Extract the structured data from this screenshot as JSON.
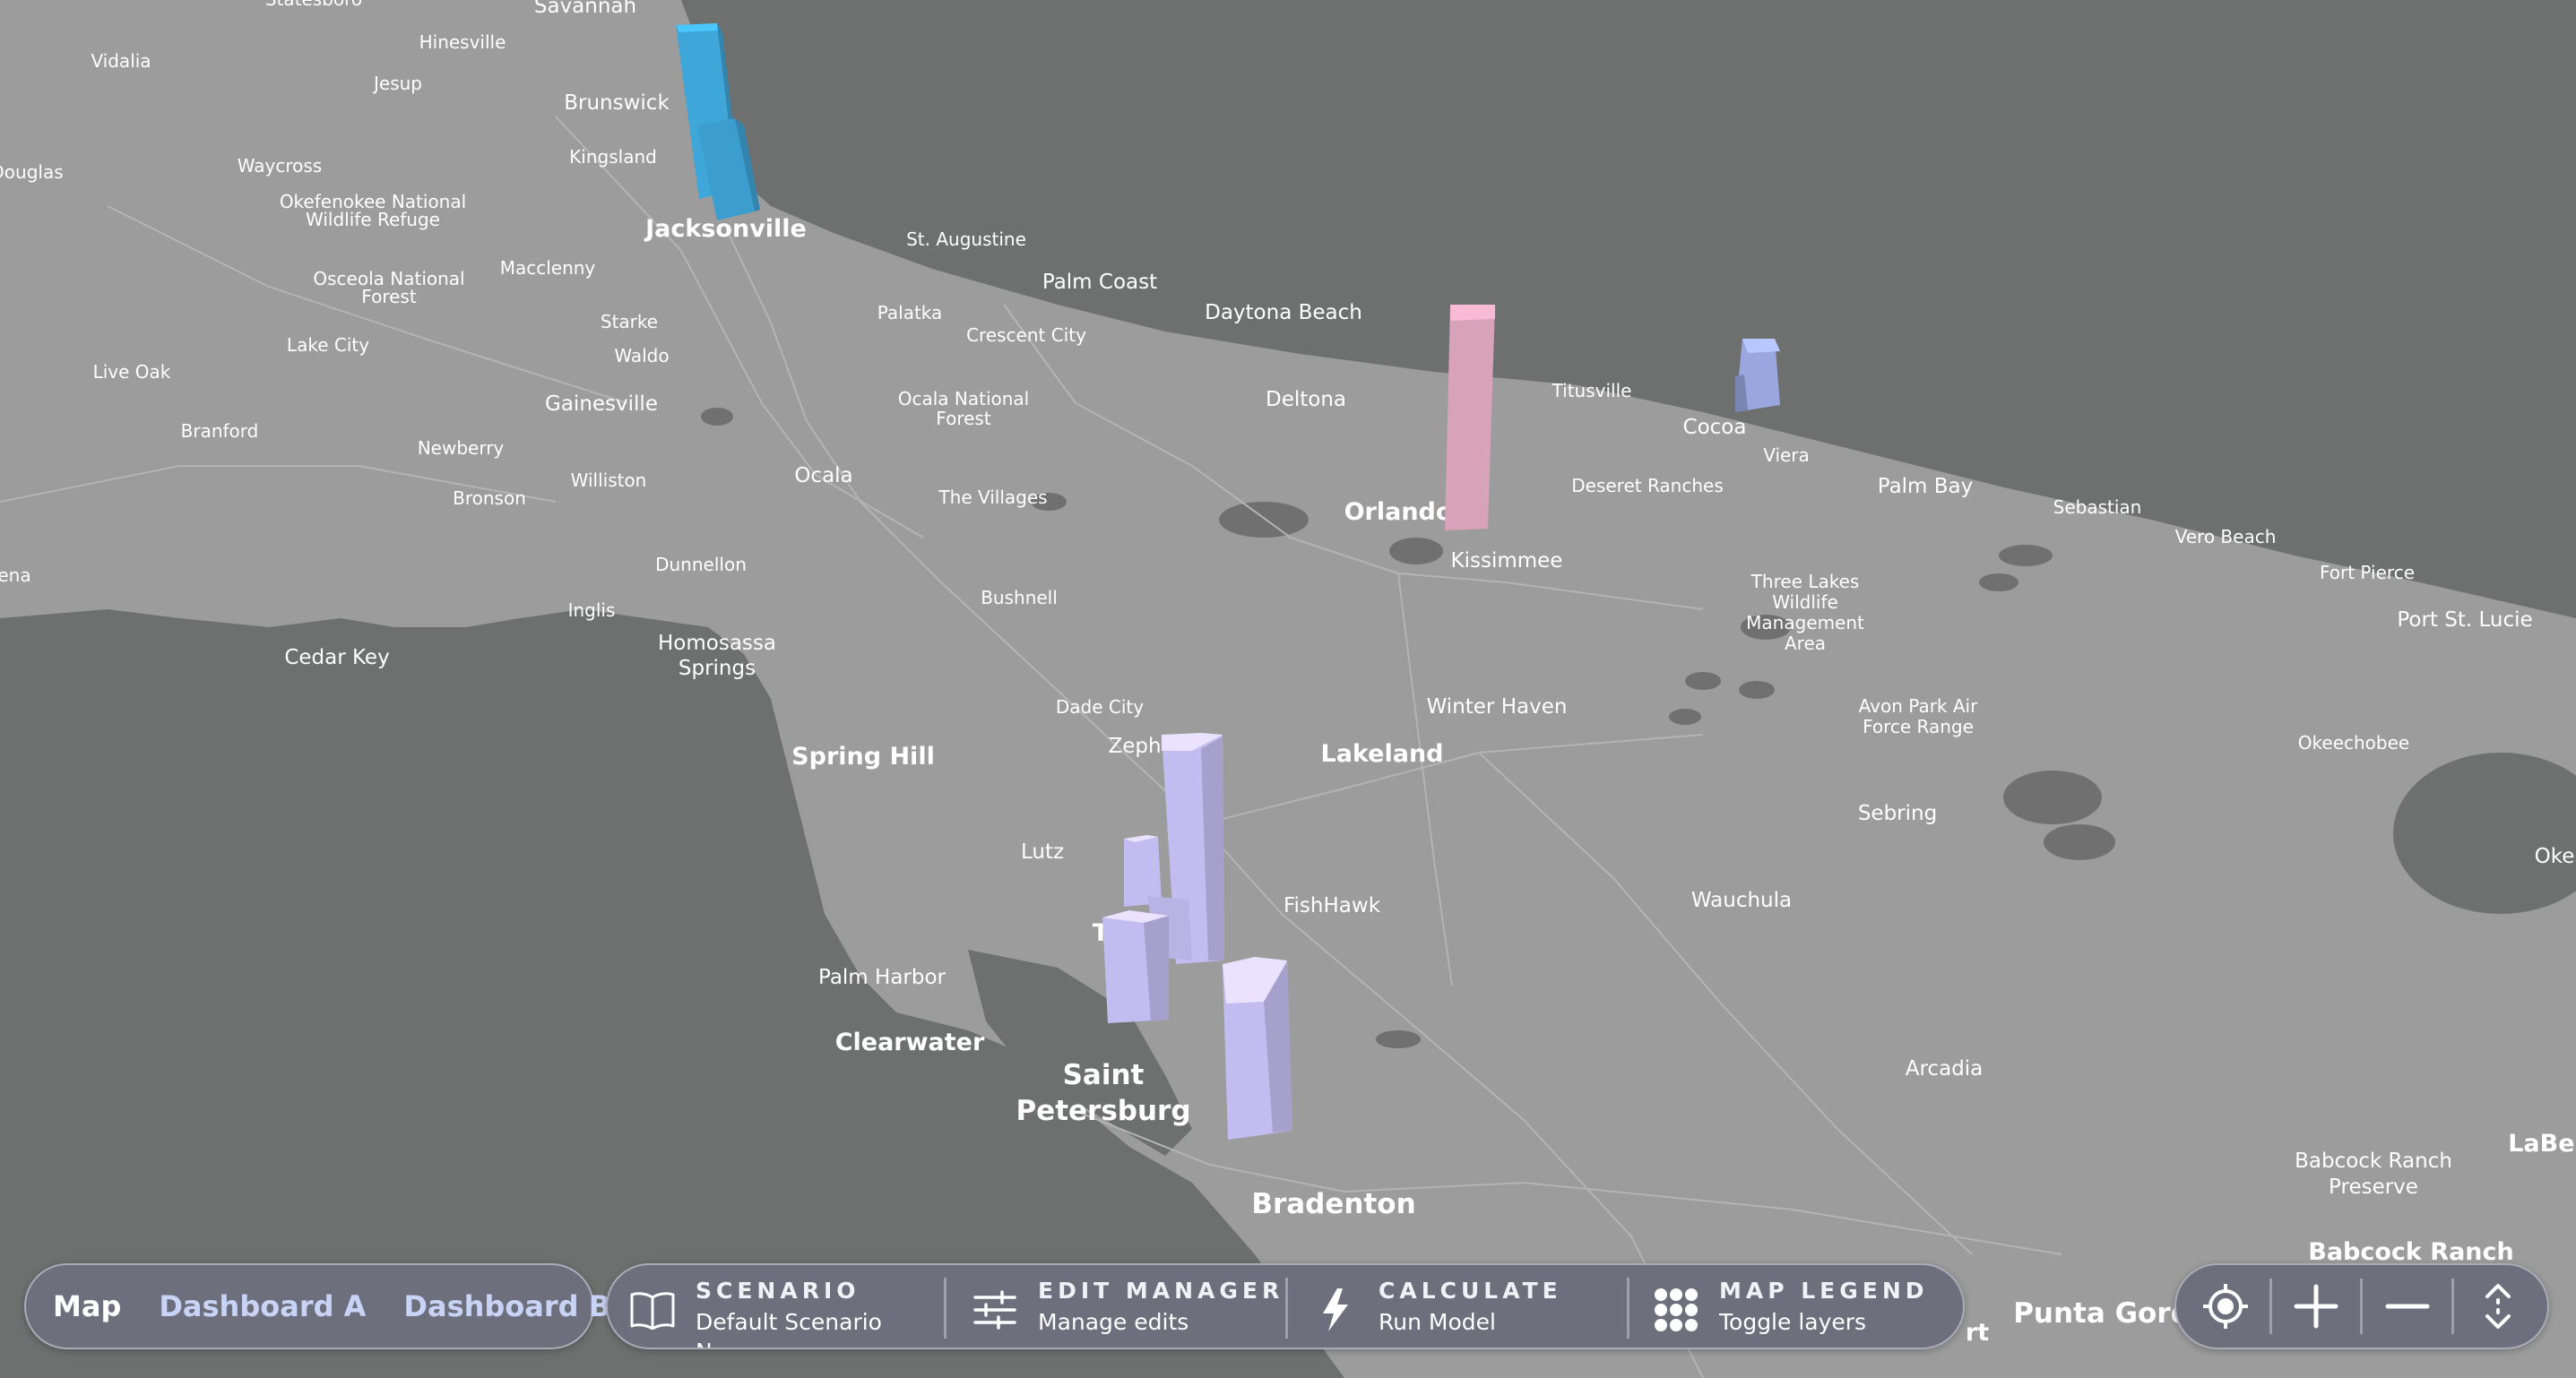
{
  "map": {
    "labels": {
      "savannah": "Savannah",
      "statesboro": "Statesboro",
      "hinesville": "Hinesville",
      "vidalia": "Vidalia",
      "jesup": "Jesup",
      "brunswick": "Brunswick",
      "douglas": "Douglas",
      "waycross": "Waycross",
      "kingsland": "Kingsland",
      "okefenokee": [
        "Okefenokee National",
        "Wildlife Refuge"
      ],
      "jacksonville": "Jacksonville",
      "st_augustine": "St. Augustine",
      "osceola": [
        "Osceola National",
        "Forest"
      ],
      "macclenny": "Macclenny",
      "palm_coast": "Palm Coast",
      "starke": "Starke",
      "palatka": "Palatka",
      "lake_city": "Lake City",
      "daytona_beach": "Daytona Beach",
      "crescent_city": "Crescent City",
      "waldo": "Waldo",
      "live_oak": "Live Oak",
      "gainesville": "Gainesville",
      "ocala_nf": [
        "Ocala National",
        "Forest"
      ],
      "deltona": "Deltona",
      "titusville": "Titusville",
      "branford": "Branford",
      "cocoa": "Cocoa",
      "newberry": "Newberry",
      "viera": "Viera",
      "williston": "Williston",
      "ocala": "Ocala",
      "deseret_ranches": "Deseret Ranches",
      "palm_bay": "Palm Bay",
      "bronson": "Bronson",
      "the_villages": "The Villages",
      "orlando": "Orlando",
      "sebastian": "Sebastian",
      "vero_beach": "Vero Beach",
      "kissimmee": "Kissimmee",
      "dunnellon": "Dunnellon",
      "fort_pierce": "Fort Pierce",
      "three_lakes": [
        "Three Lakes",
        "Wildlife",
        "Management",
        "Area"
      ],
      "port_st_lucie": "Port St. Lucie",
      "bushnell": "Bushnell",
      "inglis": "Inglis",
      "ena": "ena",
      "homosassa": [
        "Homosassa",
        "Springs"
      ],
      "cedar_key": "Cedar Key",
      "dade_city": "Dade City",
      "winter_haven": "Winter Haven",
      "avon_park": [
        "Avon Park Air",
        "Force Range"
      ],
      "okeechobee": "Okeechobee",
      "spring_hill": "Spring Hill",
      "zephyrhills": "Zeph",
      "lakeland": "Lakeland",
      "sebring": "Sebring",
      "lutz": "Lutz",
      "lake_okeechobee": "Oke",
      "fishhawk": "FishHawk",
      "wauchula": "Wauchula",
      "tampa": "T",
      "palm_harbor": "Palm Harbor",
      "clearwater": "Clearwater",
      "arcadia": "Arcadia",
      "saint_petersburg": [
        "Saint",
        "Petersburg"
      ],
      "labelle": "LaBel",
      "babcock_preserve": [
        "Babcock Ranch",
        "Preserve"
      ],
      "bradenton": "Bradenton",
      "babcock_ranch": "Babcock Ranch",
      "punta_gorda": "Punta Gord",
      "port_charlotte": "rt"
    },
    "columns": [
      {
        "place": "Jacksonville",
        "color": "#3ea6d9",
        "height": 0.85
      },
      {
        "place": "Jacksonville",
        "color": "#3ea6d9",
        "height": 0.45
      },
      {
        "place": "Orlando",
        "color": "#d8a2b8",
        "height": 1.0
      },
      {
        "place": "Cocoa",
        "color": "#9aa6de",
        "height": 0.3
      },
      {
        "place": "Tampa",
        "color": "#c3bcf0",
        "height": 0.9
      },
      {
        "place": "Tampa",
        "color": "#c3bcf0",
        "height": 0.45
      },
      {
        "place": "Tampa",
        "color": "#c3bcf0",
        "height": 0.45
      },
      {
        "place": "Tampa",
        "color": "#c3bcf0",
        "height": 0.55
      },
      {
        "place": "Tampa",
        "color": "#c3bcf0",
        "height": 0.75
      }
    ]
  },
  "view_tabs": [
    {
      "label": "Map",
      "active": true
    },
    {
      "label": "Dashboard A",
      "active": false
    },
    {
      "label": "Dashboard B",
      "active": false
    }
  ],
  "toolbar": {
    "scenario": {
      "title": "SCENARIO",
      "subtitle": "Default Scenario",
      "extra": "N...",
      "icon": "book-icon"
    },
    "edit_manager": {
      "title": "EDIT MANAGER",
      "subtitle": "Manage edits",
      "icon": "sliders-icon"
    },
    "calculate": {
      "title": "CALCULATE",
      "subtitle": "Run Model",
      "icon": "lightning-icon"
    },
    "map_legend": {
      "title": "MAP LEGEND",
      "subtitle": "Toggle layers",
      "icon": "dots-grid-icon"
    }
  },
  "map_controls": [
    "locate-icon",
    "zoom-in-icon",
    "zoom-out-icon",
    "pitch-icon"
  ],
  "colors": {
    "ocean": "#6e6f6f",
    "land": "#9b9b9b",
    "panel": "#6d6f7c",
    "panel_border": "#a9abb8",
    "tab_inactive": "#c9d3f6"
  }
}
